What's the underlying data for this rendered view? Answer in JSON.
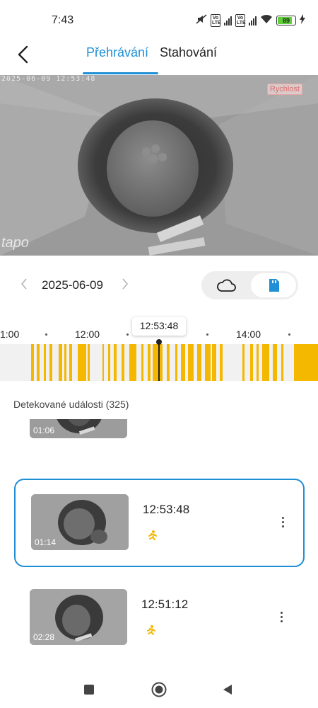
{
  "status_bar": {
    "time": "7:43",
    "battery": "89",
    "battery_level": 0.89,
    "volte_label": "Vo LTE",
    "icons": [
      "mute-icon",
      "volte-icon",
      "signal-icon",
      "volte-icon",
      "signal-icon",
      "wifi-icon",
      "battery-icon",
      "charging-icon"
    ]
  },
  "header": {
    "back_icon": "back-arrow-icon",
    "tabs": [
      {
        "label": "Přehrávání",
        "active": true
      },
      {
        "label": "Stahování",
        "active": false
      }
    ]
  },
  "video": {
    "timestamp": "2025-06-09 12:53:48",
    "speed_label": "Rychlost",
    "watermark": "tapo"
  },
  "date_nav": {
    "date": "2025-06-09",
    "prev_icon": "chevron-left-icon",
    "next_icon": "chevron-right-icon",
    "storage_options": [
      {
        "icon": "cloud-icon",
        "selected": false
      },
      {
        "icon": "sd-card-icon",
        "selected": true
      }
    ]
  },
  "timeline": {
    "labels": [
      "1:00",
      "12:00",
      "14:00"
    ],
    "current_time": "12:53:48",
    "colors": {
      "event": "#f5b800",
      "track": "#f1f1f1"
    }
  },
  "events": {
    "title": "Detekované události (325)",
    "items": [
      {
        "time": "",
        "duration": "01:06",
        "icon": "motion-person-icon",
        "selected": false
      },
      {
        "time": "12:53:48",
        "duration": "01:14",
        "icon": "motion-person-icon",
        "selected": true
      },
      {
        "time": "12:51:12",
        "duration": "02:28",
        "icon": "motion-person-icon",
        "selected": false
      }
    ]
  },
  "nav_bar": {
    "icons": [
      "recents-square-icon",
      "home-circle-icon",
      "back-triangle-icon"
    ]
  },
  "colors": {
    "accent": "#1f8fd6",
    "event_yellow": "#f5b800",
    "speed_badge": "#e06a6a"
  }
}
